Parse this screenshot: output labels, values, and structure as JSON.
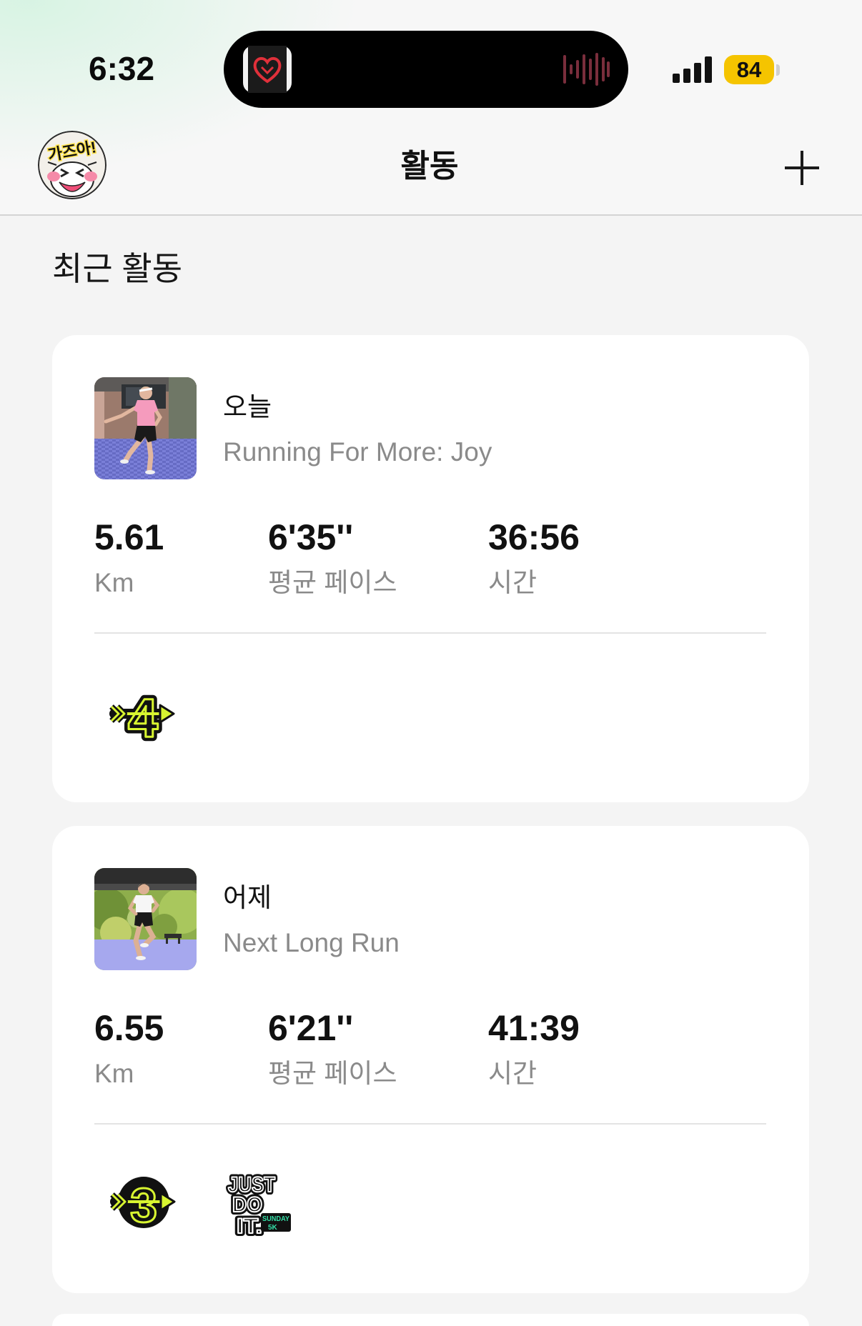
{
  "status_bar": {
    "time": "6:32",
    "battery_level": "84",
    "island_app_icon": "heart-logo-icon",
    "island_activity_icon": "waveform-icon",
    "signal_icon": "cellular-signal-icon"
  },
  "header": {
    "avatar_text": "가즈아!",
    "title": "활동",
    "add_icon": "plus-icon"
  },
  "section_title": "최근 활동",
  "activities": [
    {
      "day": "오늘",
      "name": "Running For More: Joy",
      "stats": [
        {
          "value": "5.61",
          "label": "Km"
        },
        {
          "value": "6'35''",
          "label": "평균 페이스"
        },
        {
          "value": "36:56",
          "label": "시간"
        }
      ],
      "badges": [
        {
          "icon": "arrow-milestone-badge-icon",
          "text": "4"
        }
      ]
    },
    {
      "day": "어제",
      "name": "Next Long Run",
      "stats": [
        {
          "value": "6.55",
          "label": "Km"
        },
        {
          "value": "6'21''",
          "label": "평균 페이스"
        },
        {
          "value": "41:39",
          "label": "시간"
        }
      ],
      "badges": [
        {
          "icon": "arrow-milestone-badge-icon",
          "text": "3"
        },
        {
          "icon": "just-do-it-badge-icon",
          "lines": [
            "JUST",
            "DO",
            "IT."
          ],
          "caption": [
            "SUNDAY",
            "5K"
          ]
        }
      ]
    }
  ],
  "colors": {
    "background": "#f4f4f4",
    "card": "#ffffff",
    "text_primary": "#111111",
    "text_secondary": "#8a8a8a",
    "battery": "#f5c400",
    "badge_neon": "#d8f530",
    "badge_teal": "#35e0a8",
    "waveform": "#7a2e3c",
    "heart_logo": "#e0303a"
  }
}
